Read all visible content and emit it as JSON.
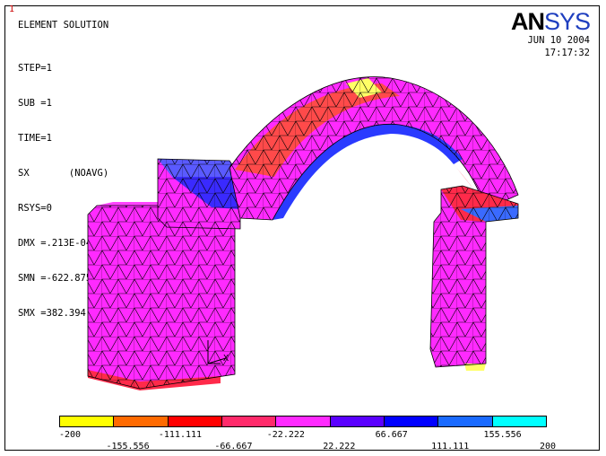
{
  "window_number": "1",
  "title": "ELEMENT SOLUTION",
  "info_lines": {
    "step": "STEP=1",
    "sub": "SUB =1",
    "time": "TIME=1",
    "sx": "SX       (NOAVG)",
    "rsys": "RSYS=0",
    "dmx": "DMX =.213E-04",
    "smn": "SMN =-622.875",
    "smx": "SMX =382.394"
  },
  "logo": {
    "an": "AN",
    "sys": "SYS"
  },
  "date": "JUN 10 2004",
  "time": "17:17:32",
  "axis_label": "X",
  "legend": {
    "colors": [
      "#ffff00",
      "#ff6a00",
      "#ff0000",
      "#ff2a6a",
      "#ff2aff",
      "#5a00ff",
      "#0000ff",
      "#1a6aff",
      "#00ffff"
    ],
    "top_labels": [
      "-200",
      "-111.111",
      "-22.222",
      "66.667",
      "155.556"
    ],
    "bottom_labels": [
      "-155.556",
      "-66.667",
      "22.222",
      "111.111",
      "200"
    ]
  },
  "colors": {
    "magenta": "#ff2aff",
    "blue": "#2a3aff",
    "red": "#ff2a4a",
    "wire": "#000000"
  }
}
